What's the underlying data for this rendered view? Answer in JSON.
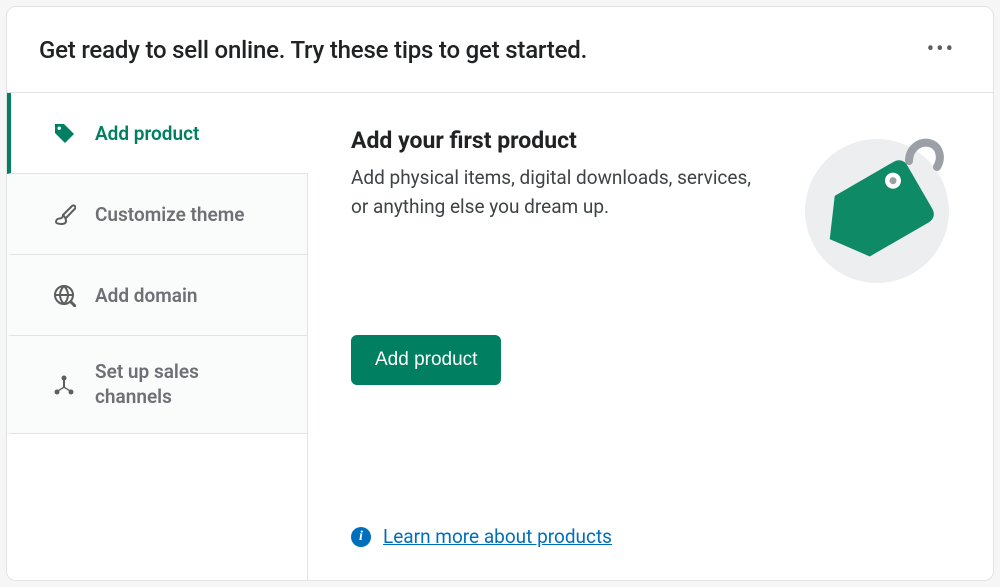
{
  "header": {
    "title": "Get ready to sell online. Try these tips to get started."
  },
  "sidebar": {
    "items": [
      {
        "label": "Add product"
      },
      {
        "label": "Customize theme"
      },
      {
        "label": "Add domain"
      },
      {
        "label": "Set up sales channels"
      }
    ]
  },
  "main": {
    "title": "Add your first product",
    "description": "Add physical items, digital downloads, services, or anything else you dream up.",
    "cta_label": "Add product",
    "learn_more_label": "Learn more about products"
  },
  "colors": {
    "brand_green": "#008060",
    "link_blue": "#006fbb"
  }
}
